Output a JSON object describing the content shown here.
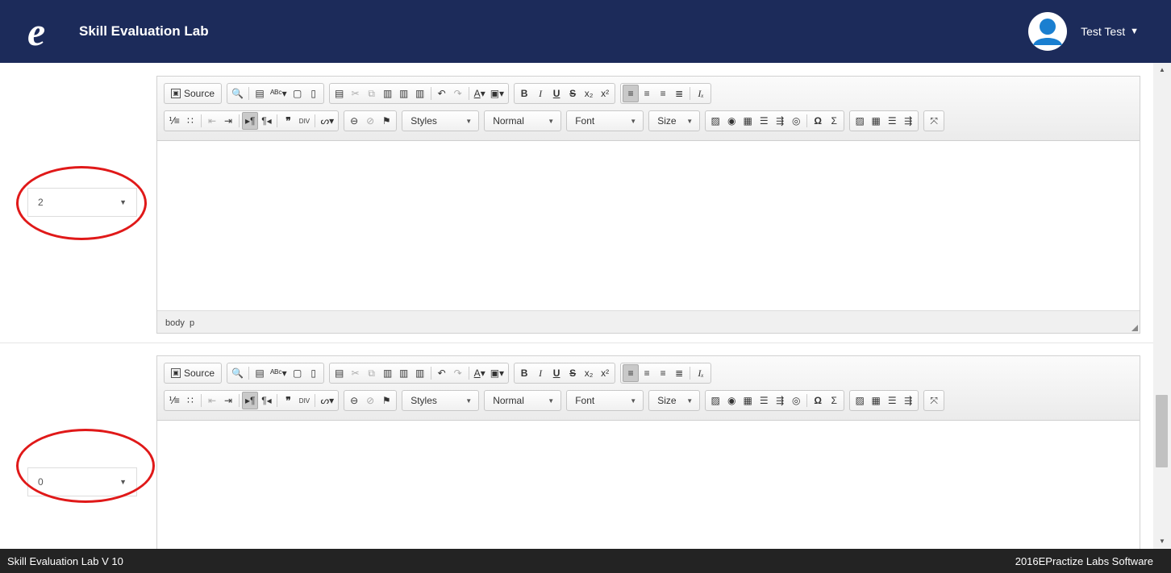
{
  "header": {
    "logo_glyph": "e",
    "brand": "Skill Evaluation Lab",
    "user_name": "Test Test",
    "user_caret": "▼"
  },
  "rows": [
    {
      "score_value": "2"
    },
    {
      "score_value": "0"
    }
  ],
  "editor": {
    "source_label": "Source",
    "styles_label": "Styles",
    "format_label": "Normal",
    "font_label": "Font",
    "size_label": "Size",
    "path_body": "body",
    "path_p": "p"
  },
  "footer": {
    "left": "Skill Evaluation Lab V 10",
    "right": "2016EPractize Labs Software"
  },
  "colors": {
    "navbar": "#1c2b5a",
    "footer": "#232323",
    "highlight_ellipse": "#e01919"
  }
}
